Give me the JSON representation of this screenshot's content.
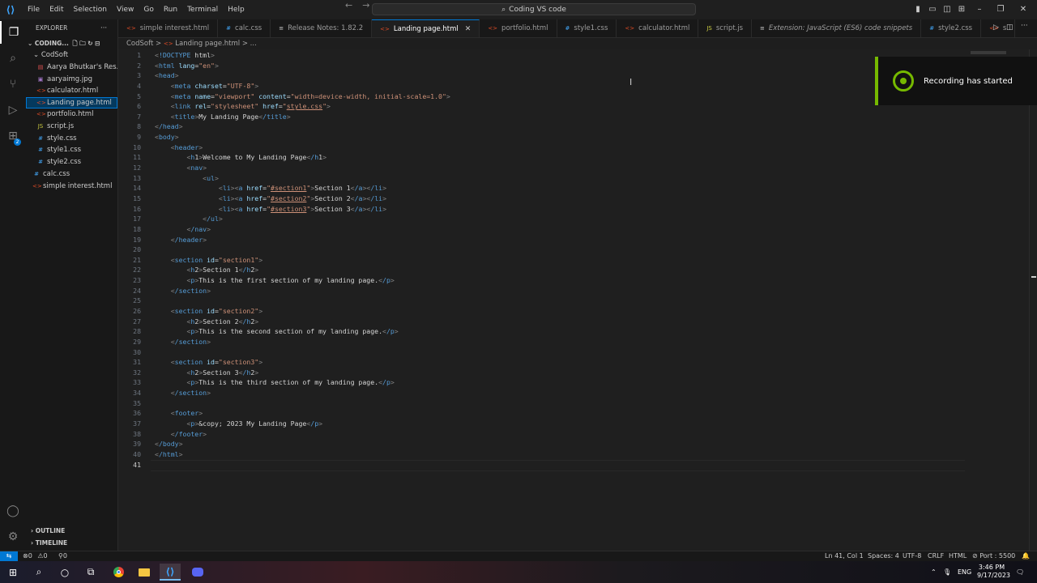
{
  "menu": [
    "File",
    "Edit",
    "Selection",
    "View",
    "Go",
    "Run",
    "Terminal",
    "Help"
  ],
  "search": {
    "text": "Coding VS code"
  },
  "sidebar": {
    "title": "EXPLORER",
    "workspace": "CODING...",
    "folder": "CodSoft",
    "files": [
      {
        "name": "Aarya Bhutkar's Res...",
        "icon": "pdf-icon",
        "color": "#e05252"
      },
      {
        "name": "aaryaimg.jpg",
        "icon": "image-icon",
        "color": "#a074c4"
      },
      {
        "name": "calculator.html",
        "icon": "html-icon",
        "color": "#e44d26"
      },
      {
        "name": "Landing page.html",
        "icon": "html-icon",
        "color": "#e44d26"
      },
      {
        "name": "portfolio.html",
        "icon": "html-icon",
        "color": "#e44d26"
      },
      {
        "name": "script.js",
        "icon": "js-icon",
        "color": "#cbcb41"
      },
      {
        "name": "style.css",
        "icon": "css-icon",
        "color": "#42a5f5"
      },
      {
        "name": "style1.css",
        "icon": "css-icon",
        "color": "#42a5f5"
      },
      {
        "name": "style2.css",
        "icon": "css-icon",
        "color": "#42a5f5"
      }
    ],
    "root_files": [
      {
        "name": "calc.css",
        "icon": "css-icon",
        "color": "#42a5f5"
      },
      {
        "name": "simple interest.html",
        "icon": "html-icon",
        "color": "#e44d26"
      }
    ],
    "outline": "OUTLINE",
    "timeline": "TIMELINE"
  },
  "tabs": [
    {
      "label": "simple interest.html",
      "icon": "html-icon",
      "glyph": "<>",
      "color": "#e44d26"
    },
    {
      "label": "calc.css",
      "icon": "css-icon",
      "glyph": "#",
      "color": "#42a5f5"
    },
    {
      "label": "Release Notes: 1.82.2",
      "icon": "release-notes-icon",
      "glyph": "≡",
      "color": "#cccccc"
    },
    {
      "label": "Landing page.html",
      "icon": "html-icon",
      "glyph": "<>",
      "color": "#e44d26",
      "active": true
    },
    {
      "label": "portfolio.html",
      "icon": "html-icon",
      "glyph": "<>",
      "color": "#e44d26"
    },
    {
      "label": "style1.css",
      "icon": "css-icon",
      "glyph": "#",
      "color": "#42a5f5"
    },
    {
      "label": "calculator.html",
      "icon": "html-icon",
      "glyph": "<>",
      "color": "#e44d26"
    },
    {
      "label": "script.js",
      "icon": "js-icon",
      "glyph": "JS",
      "color": "#cbcb41"
    },
    {
      "label": "Extension: JavaScript (ES6) code snippets",
      "icon": "extension-icon",
      "glyph": "≡",
      "color": "#cccccc",
      "italic": true
    },
    {
      "label": "style2.css",
      "icon": "css-icon",
      "glyph": "#",
      "color": "#42a5f5"
    },
    {
      "label": "s",
      "icon": "html-icon",
      "glyph": "<>",
      "color": "#e44d26"
    }
  ],
  "breadcrumb": {
    "folder": "CodSoft",
    "sep": ">",
    "file": "Landing page.html",
    "tail": "> ..."
  },
  "code_lines": [
    "<!DOCTYPE html>",
    "<html lang=\"en\">",
    "<head>",
    "    <meta charset=\"UTF-8\">",
    "    <meta name=\"viewport\" content=\"width=device-width, initial-scale=1.0\">",
    "    <link rel=\"stylesheet\" href=\"style.css\">",
    "    <title>My Landing Page</title>",
    "</head>",
    "<body>",
    "    <header>",
    "        <h1>Welcome to My Landing Page</h1>",
    "        <nav>",
    "            <ul>",
    "                <li><a href=\"#section1\">Section 1</a></li>",
    "                <li><a href=\"#section2\">Section 2</a></li>",
    "                <li><a href=\"#section3\">Section 3</a></li>",
    "            </ul>",
    "        </nav>",
    "    </header>",
    "",
    "    <section id=\"section1\">",
    "        <h2>Section 1</h2>",
    "        <p>This is the first section of my landing page.</p>",
    "    </section>",
    "",
    "    <section id=\"section2\">",
    "        <h2>Section 2</h2>",
    "        <p>This is the second section of my landing page.</p>",
    "    </section>",
    "",
    "    <section id=\"section3\">",
    "        <h2>Section 3</h2>",
    "        <p>This is the third section of my landing page.</p>",
    "    </section>",
    "",
    "    <footer>",
    "        <p>&copy; 2023 My Landing Page</p>",
    "    </footer>",
    "</body>",
    "</html>",
    ""
  ],
  "cursor_line": 41,
  "notification": {
    "text": "Recording has started",
    "accent": "#76b900"
  },
  "status": {
    "errors": "0",
    "warnings": "0",
    "ports": "0",
    "position": "Ln 41, Col 1",
    "spaces": "Spaces: 4",
    "encoding": "UTF-8",
    "eol": "CRLF",
    "language": "HTML",
    "port": "Port : 5500"
  },
  "taskbar": {
    "lang": "ENG",
    "time": "3:46 PM",
    "date": "9/17/2023"
  },
  "colors": {
    "accent": "#0078d4",
    "editor_bg": "#1f1f1f"
  }
}
